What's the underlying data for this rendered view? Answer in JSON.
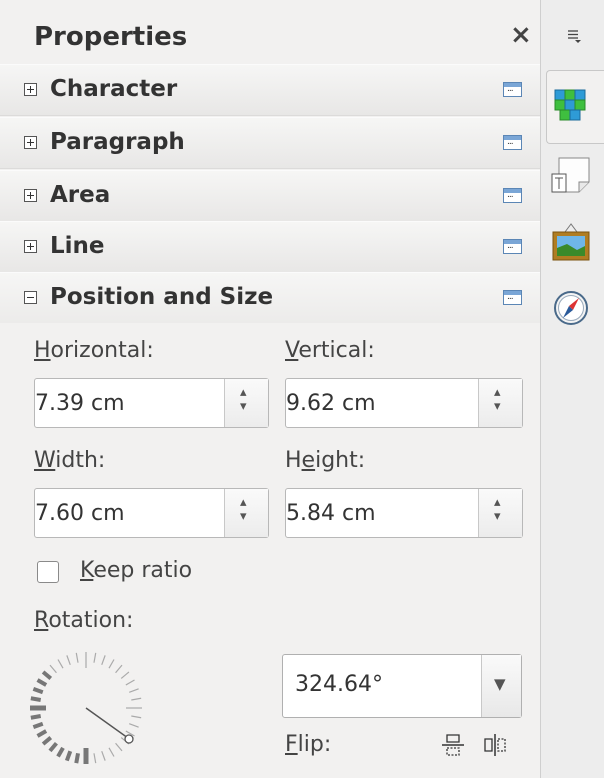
{
  "panel": {
    "title": "Properties",
    "close_label": "×"
  },
  "sections": [
    {
      "label": "Character",
      "expanded": false
    },
    {
      "label": "Paragraph",
      "expanded": false
    },
    {
      "label": "Area",
      "expanded": false
    },
    {
      "label": "Line",
      "expanded": false
    },
    {
      "label": "Position and Size",
      "expanded": true
    }
  ],
  "position_size": {
    "horizontal": {
      "label_u": "H",
      "label_rest": "orizontal:",
      "value": "7.39 cm"
    },
    "vertical": {
      "label_u": "V",
      "label_rest": "ertical:",
      "value": "9.62 cm"
    },
    "width": {
      "label_u": "W",
      "label_rest": "idth:",
      "value": "7.60 cm"
    },
    "height": {
      "label_pre": "H",
      "label_u": "e",
      "label_rest": "ight:",
      "value": "5.84 cm"
    },
    "keep_ratio": {
      "label_u": "K",
      "label_rest": "eep ratio",
      "checked": false
    },
    "rotation": {
      "label_u": "R",
      "label_rest": "otation:",
      "value": "324.64°"
    },
    "flip": {
      "label_u": "F",
      "label_rest": "lip:"
    }
  },
  "tabbar": {
    "icons": [
      "menu-icon",
      "properties-icon",
      "styles-icon",
      "gallery-icon",
      "navigator-icon"
    ],
    "selected": "properties-icon"
  },
  "colors": {
    "accent": "#5b86b5",
    "panel_bg": "#f2f1f0"
  }
}
